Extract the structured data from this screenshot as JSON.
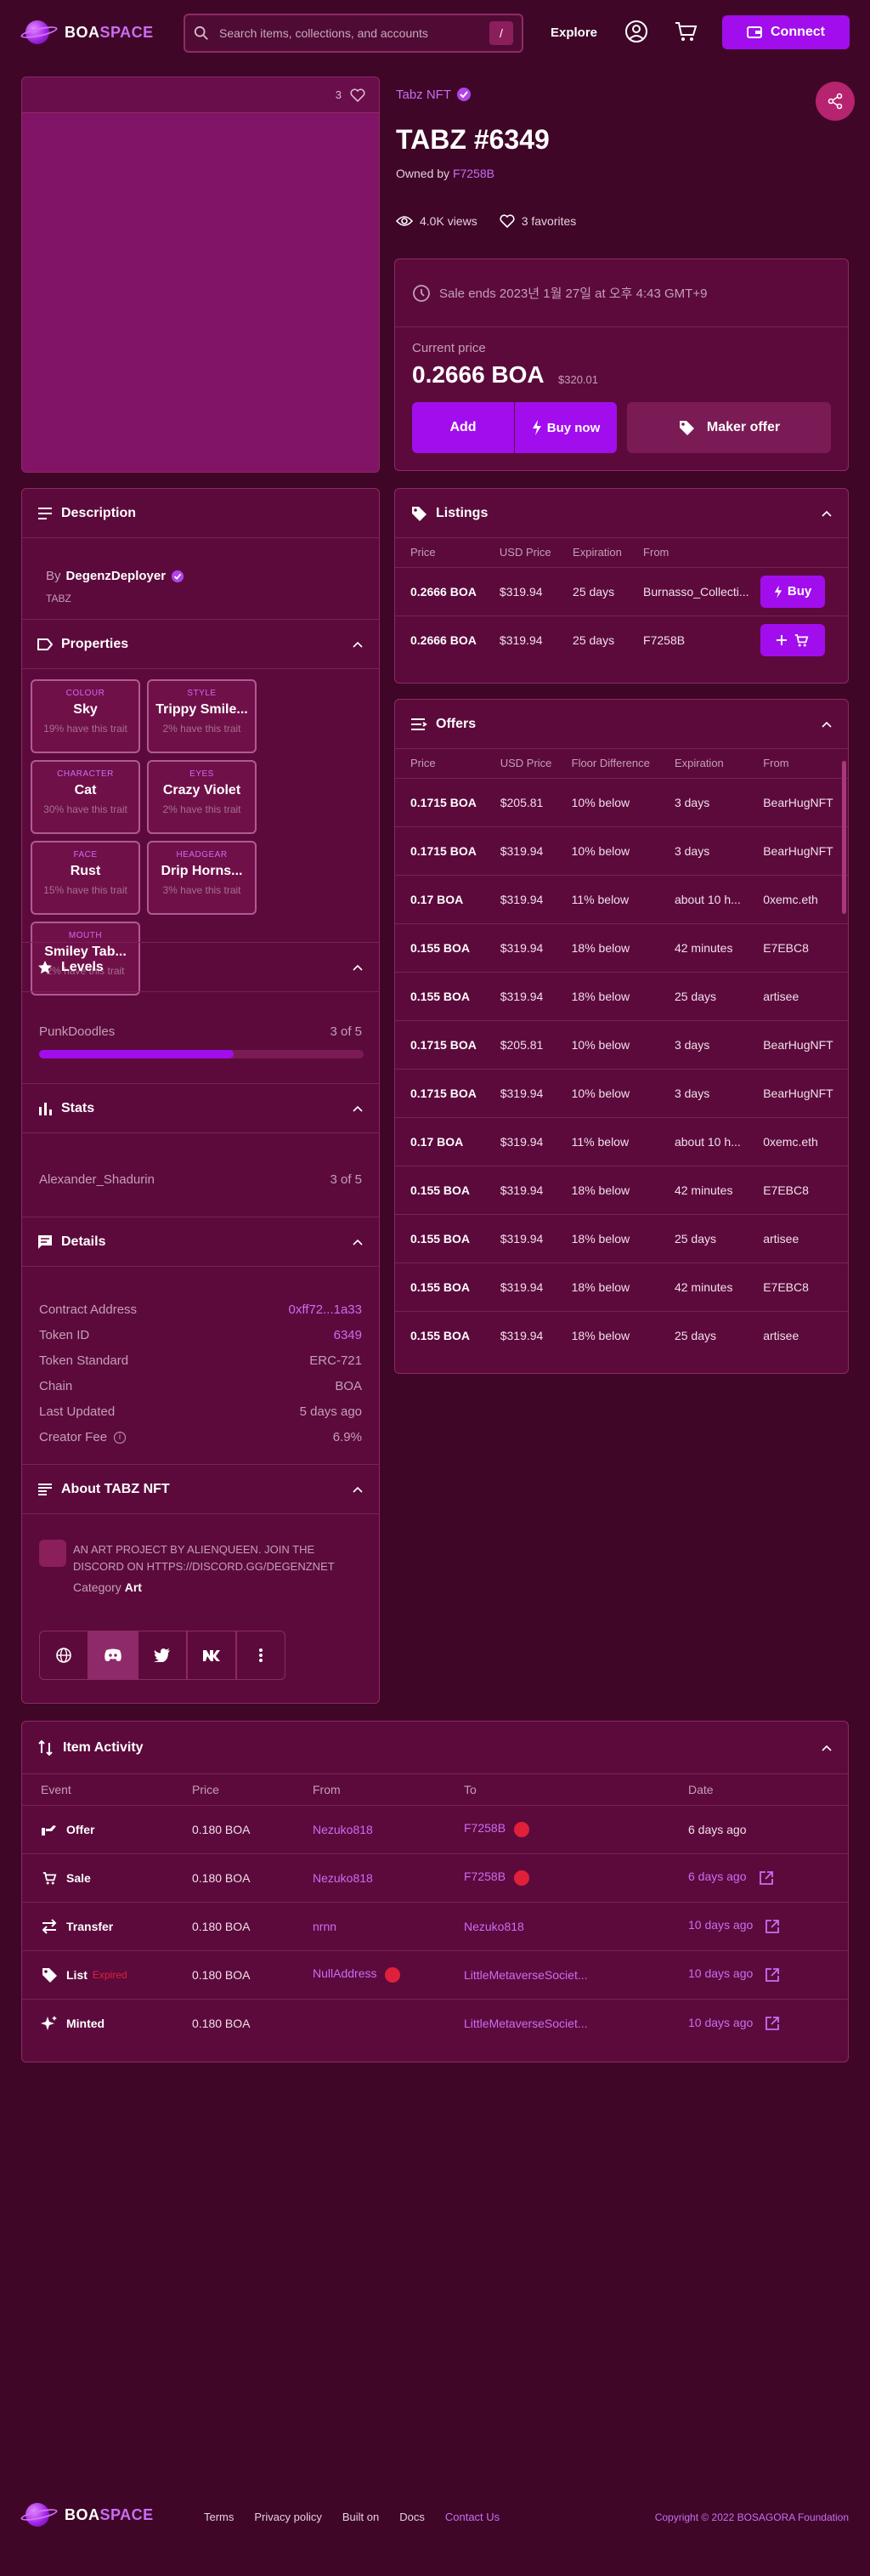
{
  "brand": {
    "name_a": "BOA",
    "name_b": "SPACE"
  },
  "header": {
    "search_placeholder": "Search items, collections, and accounts",
    "slash": "/",
    "explore": "Explore",
    "connect": "Connect"
  },
  "media": {
    "favorites_count": "3"
  },
  "item": {
    "collection": "Tabz NFT",
    "title": "TABZ #6349",
    "owned_by_label": "Owned by",
    "owner": "F7258B",
    "views": "4.0K views",
    "favorites": "3 favorites"
  },
  "sale": {
    "ends": "Sale ends 2023년 1월 27일 at 오후 4:43 GMT+9",
    "current_price_label": "Current price",
    "price": "0.2666 BOA",
    "price_usd": "$320.01",
    "add": "Add",
    "buy_now": "Buy now",
    "maker_offer": "Maker offer"
  },
  "description": {
    "title": "Description",
    "by_label": "By",
    "creator": "DegenzDeployer",
    "collection_tag": "TABZ"
  },
  "properties": {
    "title": "Properties",
    "items": [
      {
        "type": "COLOUR",
        "value": "Sky",
        "pct": "19% have this trait"
      },
      {
        "type": "STYLE",
        "value": "Trippy Smile...",
        "pct": "2% have this trait"
      },
      {
        "type": "CHARACTER",
        "value": "Cat",
        "pct": "30% have this trait"
      },
      {
        "type": "EYES",
        "value": "Crazy Violet",
        "pct": "2% have this trait"
      },
      {
        "type": "FACE",
        "value": "Rust",
        "pct": "15% have this trait"
      },
      {
        "type": "HEADGEAR",
        "value": "Drip Horns...",
        "pct": "3% have this trait"
      },
      {
        "type": "MOUTH",
        "value": "Smiley Tab...",
        "pct": "2% have this trait"
      }
    ]
  },
  "levels": {
    "title": "Levels",
    "name": "PunkDoodles",
    "value": "3 of 5",
    "fraction": 0.6
  },
  "stats": {
    "title": "Stats",
    "name": "Alexander_Shadurin",
    "value": "3 of 5"
  },
  "details": {
    "title": "Details",
    "rows": [
      {
        "k": "Contract Address",
        "v": "0xff72...1a33",
        "link": true
      },
      {
        "k": "Token ID",
        "v": "6349",
        "link": true
      },
      {
        "k": "Token Standard",
        "v": "ERC-721",
        "link": false
      },
      {
        "k": "Chain",
        "v": "BOA",
        "link": false
      },
      {
        "k": "Last Updated",
        "v": "5 days ago",
        "link": false
      },
      {
        "k": "Creator Fee",
        "v": "6.9%",
        "link": false
      }
    ]
  },
  "about": {
    "title": "About TABZ NFT",
    "text": "AN ART PROJECT BY ALIENQUEEN. JOIN THE DISCORD ON HTTPS://DISCORD.GG/DEGENZNET",
    "category_label": "Category",
    "category": "Art"
  },
  "listings": {
    "title": "Listings",
    "headers": [
      "Price",
      "USD Price",
      "Expiration",
      "From"
    ],
    "rows": [
      {
        "price": "0.2666 BOA",
        "usd": "$319.94",
        "exp": "25 days",
        "from": "Burnasso_Collecti...",
        "btn": "Buy"
      },
      {
        "price": "0.2666 BOA",
        "usd": "$319.94",
        "exp": "25 days",
        "from": "F7258B",
        "btn": ""
      }
    ]
  },
  "offers": {
    "title": "Offers",
    "headers": [
      "Price",
      "USD Price",
      "Floor Difference",
      "Expiration",
      "From"
    ],
    "rows": [
      {
        "price": "0.1715 BOA",
        "usd": "$205.81",
        "diff": "10% below",
        "exp": "3 days",
        "from": "BearHugNFT"
      },
      {
        "price": "0.1715 BOA",
        "usd": "$319.94",
        "diff": "10% below",
        "exp": "3 days",
        "from": "BearHugNFT"
      },
      {
        "price": "0.17 BOA",
        "usd": "$319.94",
        "diff": "11% below",
        "exp": "about 10 h...",
        "from": "0xemc.eth"
      },
      {
        "price": "0.155 BOA",
        "usd": "$319.94",
        "diff": "18% below",
        "exp": "42 minutes",
        "from": "E7EBC8"
      },
      {
        "price": "0.155 BOA",
        "usd": "$319.94",
        "diff": "18% below",
        "exp": "25 days",
        "from": "artisee"
      },
      {
        "price": "0.1715 BOA",
        "usd": "$205.81",
        "diff": "10% below",
        "exp": "3 days",
        "from": "BearHugNFT"
      },
      {
        "price": "0.1715 BOA",
        "usd": "$319.94",
        "diff": "10% below",
        "exp": "3 days",
        "from": "BearHugNFT"
      },
      {
        "price": "0.17 BOA",
        "usd": "$319.94",
        "diff": "11% below",
        "exp": "about 10 h...",
        "from": "0xemc.eth"
      },
      {
        "price": "0.155 BOA",
        "usd": "$319.94",
        "diff": "18% below",
        "exp": "42 minutes",
        "from": "E7EBC8"
      },
      {
        "price": "0.155 BOA",
        "usd": "$319.94",
        "diff": "18% below",
        "exp": "25 days",
        "from": "artisee"
      },
      {
        "price": "0.155 BOA",
        "usd": "$319.94",
        "diff": "18% below",
        "exp": "42 minutes",
        "from": "E7EBC8"
      },
      {
        "price": "0.155 BOA",
        "usd": "$319.94",
        "diff": "18% below",
        "exp": "25 days",
        "from": "artisee"
      }
    ]
  },
  "activity": {
    "title": "Item Activity",
    "headers": [
      "Event",
      "Price",
      "From",
      "To",
      "Date"
    ],
    "rows": [
      {
        "event": "Offer",
        "tag": "",
        "price": "0.180 BOA",
        "from": "Nezuko818",
        "from_dot": false,
        "to": "F7258B",
        "to_dot": true,
        "date": "6 days ago",
        "date_link": false
      },
      {
        "event": "Sale",
        "tag": "",
        "price": "0.180 BOA",
        "from": "Nezuko818",
        "from_dot": false,
        "to": "F7258B",
        "to_dot": true,
        "date": "6 days ago",
        "date_link": true
      },
      {
        "event": "Transfer",
        "tag": "",
        "price": "0.180 BOA",
        "from": "nrnn",
        "from_dot": false,
        "to": "Nezuko818",
        "to_dot": false,
        "date": "10 days ago",
        "date_link": true
      },
      {
        "event": "List",
        "tag": "Expired",
        "price": "0.180 BOA",
        "from": "NullAddress",
        "from_dot": true,
        "to": "LittleMetaverseSociet...",
        "to_dot": false,
        "date": "10 days ago",
        "date_link": true
      },
      {
        "event": "Minted",
        "tag": "",
        "price": "0.180 BOA",
        "from": "",
        "from_dot": false,
        "to": "LittleMetaverseSociet...",
        "to_dot": false,
        "date": "10 days ago",
        "date_link": true
      }
    ]
  },
  "footer": {
    "links": [
      "Terms",
      "Privacy policy",
      "Built on",
      "Docs",
      "Contact Us"
    ],
    "copyright": "Copyright © 2022 BOSAGORA Foundation"
  },
  "colors": {
    "bg": "#3f0627",
    "panel": "#5c0a3c",
    "accent": "#a20ded",
    "link": "#c86ef2",
    "danger": "#e0203a"
  }
}
